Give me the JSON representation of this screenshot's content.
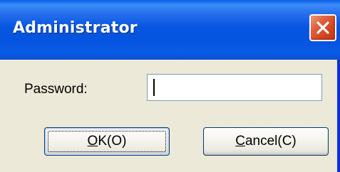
{
  "window": {
    "title": "Administrator",
    "close_icon": "close-icon"
  },
  "form": {
    "password_label": "Password:",
    "password_value": ""
  },
  "buttons": {
    "ok_accel": "O",
    "ok_rest": "K(O)",
    "cancel_accel": "C",
    "cancel_rest": "ancel(C)"
  },
  "colors": {
    "titlebar": "#0755e2",
    "close_button": "#d1431f",
    "dialog_background": "#ece9d8"
  }
}
